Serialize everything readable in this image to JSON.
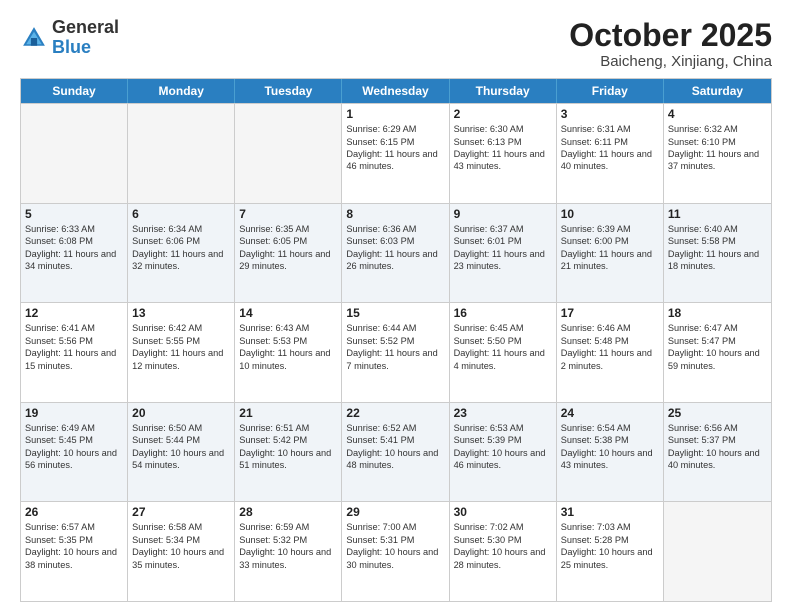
{
  "header": {
    "logo_general": "General",
    "logo_blue": "Blue",
    "title": "October 2025",
    "subtitle": "Baicheng, Xinjiang, China"
  },
  "days_of_week": [
    "Sunday",
    "Monday",
    "Tuesday",
    "Wednesday",
    "Thursday",
    "Friday",
    "Saturday"
  ],
  "weeks": [
    [
      {
        "day": "",
        "empty": true
      },
      {
        "day": "",
        "empty": true
      },
      {
        "day": "",
        "empty": true
      },
      {
        "day": "1",
        "sunrise": "6:29 AM",
        "sunset": "6:15 PM",
        "daylight": "11 hours and 46 minutes."
      },
      {
        "day": "2",
        "sunrise": "6:30 AM",
        "sunset": "6:13 PM",
        "daylight": "11 hours and 43 minutes."
      },
      {
        "day": "3",
        "sunrise": "6:31 AM",
        "sunset": "6:11 PM",
        "daylight": "11 hours and 40 minutes."
      },
      {
        "day": "4",
        "sunrise": "6:32 AM",
        "sunset": "6:10 PM",
        "daylight": "11 hours and 37 minutes."
      }
    ],
    [
      {
        "day": "5",
        "sunrise": "6:33 AM",
        "sunset": "6:08 PM",
        "daylight": "11 hours and 34 minutes."
      },
      {
        "day": "6",
        "sunrise": "6:34 AM",
        "sunset": "6:06 PM",
        "daylight": "11 hours and 32 minutes."
      },
      {
        "day": "7",
        "sunrise": "6:35 AM",
        "sunset": "6:05 PM",
        "daylight": "11 hours and 29 minutes."
      },
      {
        "day": "8",
        "sunrise": "6:36 AM",
        "sunset": "6:03 PM",
        "daylight": "11 hours and 26 minutes."
      },
      {
        "day": "9",
        "sunrise": "6:37 AM",
        "sunset": "6:01 PM",
        "daylight": "11 hours and 23 minutes."
      },
      {
        "day": "10",
        "sunrise": "6:39 AM",
        "sunset": "6:00 PM",
        "daylight": "11 hours and 21 minutes."
      },
      {
        "day": "11",
        "sunrise": "6:40 AM",
        "sunset": "5:58 PM",
        "daylight": "11 hours and 18 minutes."
      }
    ],
    [
      {
        "day": "12",
        "sunrise": "6:41 AM",
        "sunset": "5:56 PM",
        "daylight": "11 hours and 15 minutes."
      },
      {
        "day": "13",
        "sunrise": "6:42 AM",
        "sunset": "5:55 PM",
        "daylight": "11 hours and 12 minutes."
      },
      {
        "day": "14",
        "sunrise": "6:43 AM",
        "sunset": "5:53 PM",
        "daylight": "11 hours and 10 minutes."
      },
      {
        "day": "15",
        "sunrise": "6:44 AM",
        "sunset": "5:52 PM",
        "daylight": "11 hours and 7 minutes."
      },
      {
        "day": "16",
        "sunrise": "6:45 AM",
        "sunset": "5:50 PM",
        "daylight": "11 hours and 4 minutes."
      },
      {
        "day": "17",
        "sunrise": "6:46 AM",
        "sunset": "5:48 PM",
        "daylight": "11 hours and 2 minutes."
      },
      {
        "day": "18",
        "sunrise": "6:47 AM",
        "sunset": "5:47 PM",
        "daylight": "10 hours and 59 minutes."
      }
    ],
    [
      {
        "day": "19",
        "sunrise": "6:49 AM",
        "sunset": "5:45 PM",
        "daylight": "10 hours and 56 minutes."
      },
      {
        "day": "20",
        "sunrise": "6:50 AM",
        "sunset": "5:44 PM",
        "daylight": "10 hours and 54 minutes."
      },
      {
        "day": "21",
        "sunrise": "6:51 AM",
        "sunset": "5:42 PM",
        "daylight": "10 hours and 51 minutes."
      },
      {
        "day": "22",
        "sunrise": "6:52 AM",
        "sunset": "5:41 PM",
        "daylight": "10 hours and 48 minutes."
      },
      {
        "day": "23",
        "sunrise": "6:53 AM",
        "sunset": "5:39 PM",
        "daylight": "10 hours and 46 minutes."
      },
      {
        "day": "24",
        "sunrise": "6:54 AM",
        "sunset": "5:38 PM",
        "daylight": "10 hours and 43 minutes."
      },
      {
        "day": "25",
        "sunrise": "6:56 AM",
        "sunset": "5:37 PM",
        "daylight": "10 hours and 40 minutes."
      }
    ],
    [
      {
        "day": "26",
        "sunrise": "6:57 AM",
        "sunset": "5:35 PM",
        "daylight": "10 hours and 38 minutes."
      },
      {
        "day": "27",
        "sunrise": "6:58 AM",
        "sunset": "5:34 PM",
        "daylight": "10 hours and 35 minutes."
      },
      {
        "day": "28",
        "sunrise": "6:59 AM",
        "sunset": "5:32 PM",
        "daylight": "10 hours and 33 minutes."
      },
      {
        "day": "29",
        "sunrise": "7:00 AM",
        "sunset": "5:31 PM",
        "daylight": "10 hours and 30 minutes."
      },
      {
        "day": "30",
        "sunrise": "7:02 AM",
        "sunset": "5:30 PM",
        "daylight": "10 hours and 28 minutes."
      },
      {
        "day": "31",
        "sunrise": "7:03 AM",
        "sunset": "5:28 PM",
        "daylight": "10 hours and 25 minutes."
      },
      {
        "day": "",
        "empty": true
      }
    ]
  ]
}
